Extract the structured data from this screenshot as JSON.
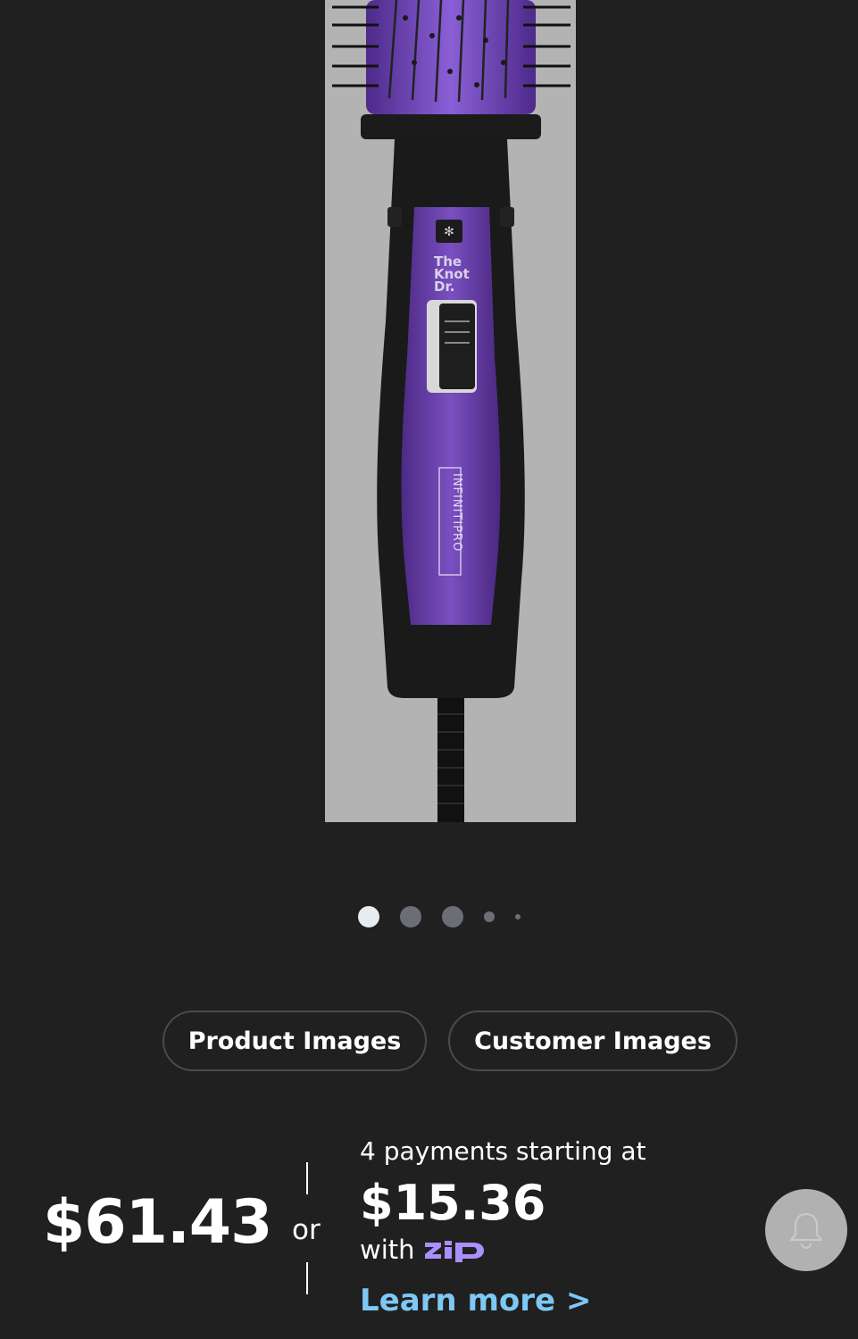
{
  "product": {
    "image_alt": "InfinitiPro by Conair The Knot Dr. hot air brush",
    "brand_text": "The Knot Dr.",
    "model_text": "INFINITIPRO"
  },
  "carousel": {
    "total": 5,
    "active_index": 0
  },
  "image_tabs": {
    "product_images": "Product Images",
    "customer_images": "Customer Images"
  },
  "pricing": {
    "price": "$61.43",
    "or": "or",
    "payments_text": "4 payments starting at",
    "installment": "$15.36",
    "with": "with",
    "provider": "zip",
    "learn_more": "Learn more >"
  },
  "colors": {
    "background": "#202020",
    "link": "#7ec8f4",
    "zip_purple": "#aa8fff",
    "dot_active": "#e6ecf2",
    "dot_inactive": "#6b6e76"
  },
  "icons": {
    "bell": "bell-icon"
  }
}
